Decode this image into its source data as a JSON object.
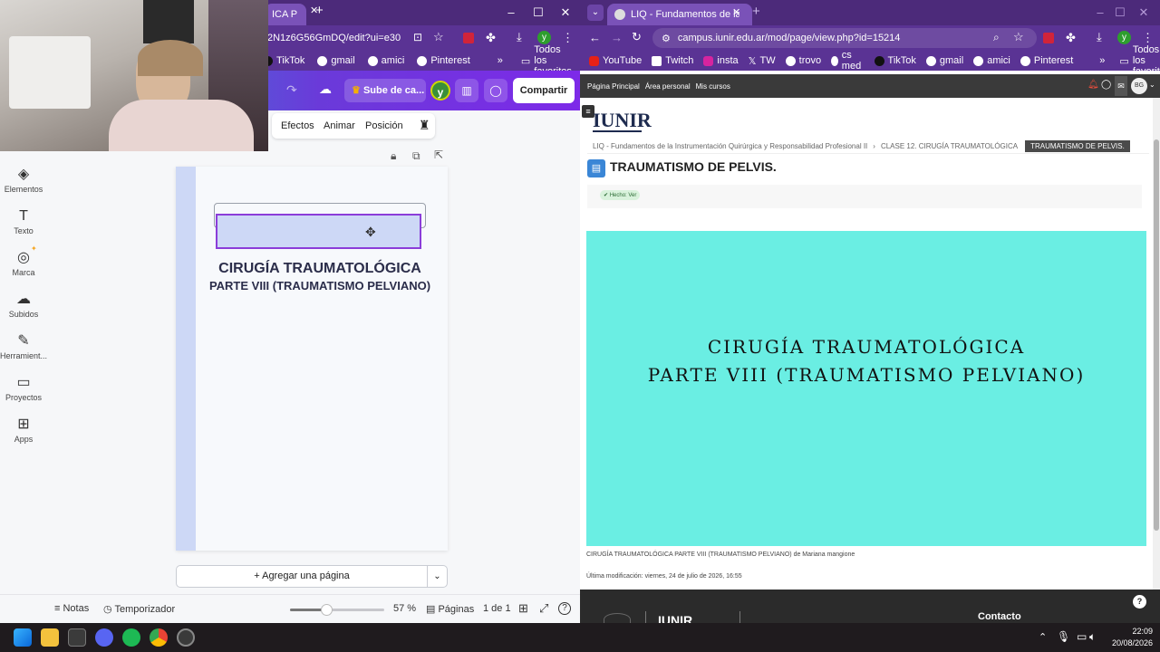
{
  "left_browser": {
    "tab_title": "ICA P",
    "url": "2N1z6G56GmDQ/edit?ui=e30",
    "bookmarks": [
      "TikTok",
      "gmail",
      "amici",
      "Pinterest"
    ],
    "favorites_label": "Todos los favoritos",
    "profile_initial": "y"
  },
  "canva": {
    "upgrade_label": "Sube de ca...",
    "share_label": "Compartir",
    "avatar_initial": "y",
    "toolbar": [
      "Efectos",
      "Animar",
      "Posición"
    ],
    "sidebar": [
      {
        "label": "Elementos",
        "icon": "elements-icon",
        "glyph": "◈"
      },
      {
        "label": "Texto",
        "icon": "text-icon",
        "glyph": "T"
      },
      {
        "label": "Marca",
        "icon": "brand-icon",
        "glyph": "◎"
      },
      {
        "label": "Subidos",
        "icon": "upload-icon",
        "glyph": "☁"
      },
      {
        "label": "Herramient...",
        "icon": "tools-icon",
        "glyph": "✎"
      },
      {
        "label": "Proyectos",
        "icon": "folder-icon",
        "glyph": "▭"
      },
      {
        "label": "Apps",
        "icon": "apps-icon",
        "glyph": "⊞"
      }
    ],
    "slide_title": "CIRUGÍA TRAUMATOLÓGICA",
    "slide_subtitle": "PARTE VIII (TRAUMATISMO PELVIANO)",
    "add_page_label": "+ Agregar una página",
    "bottom": {
      "notes": "Notas",
      "timer": "Temporizador",
      "zoom": "57 %",
      "zoom_level": 0.38,
      "pages": "Páginas",
      "page_count": "1 de 1"
    }
  },
  "right_browser": {
    "tab_title": "LIQ - Fundamentos de la Instru",
    "url": "campus.iunir.edu.ar/mod/page/view.php?id=15214",
    "bookmarks": [
      "YouTube",
      "Twitch",
      "insta",
      "TW",
      "trovo",
      "cs med",
      "TikTok",
      "gmail",
      "amici",
      "Pinterest"
    ],
    "favorites_label": "Todos los favoritos",
    "profile_initial": "y"
  },
  "moodle": {
    "nav": [
      "Página Principal",
      "Área personal",
      "Mis cursos"
    ],
    "user_initials": "BG",
    "logo": "IUNIR",
    "breadcrumb": [
      "LIQ - Fundamentos de la Instrumentación Quirúrgica y Responsabilidad Profesional II",
      "CLASE 12. CIRUGÍA TRAUMATOLÓGICA",
      "TRAUMATISMO DE PELVIS."
    ],
    "page_title": "TRAUMATISMO DE PELVIS.",
    "done_label": "✔ Hecho:",
    "done_value": "Ver",
    "banner_line1": "CIRUGÍA TRAUMATOLÓGICA",
    "banner_line2": "PARTE VIII (TRAUMATISMO PELVIANO)",
    "caption": "CIRUGÍA TRAUMATOLÓGICA PARTE VIII (TRAUMATISMO PELVIANO) de Mariana mangione",
    "last_modified": "Última modificación: viernes, 24 de julio de 2026, 16:55",
    "footer_contact": "Contacto",
    "footer_logo": "IUNIR",
    "help": "?"
  },
  "taskbar": {
    "time": "22:09",
    "date": "20/08/2026"
  },
  "colors": {
    "chrome_purple": "#5a3394",
    "canva_gradient_end": "#7d2ae8",
    "banner_teal": "#6aeee3",
    "slide_title": "#2b2d4a"
  }
}
